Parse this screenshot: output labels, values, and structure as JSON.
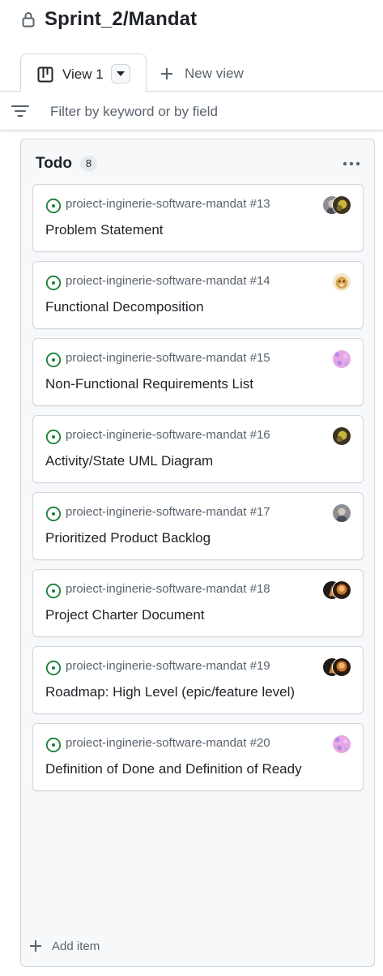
{
  "header": {
    "title": "Sprint_2/Mandat"
  },
  "tabs": {
    "view_label": "View 1",
    "new_view_label": "New view"
  },
  "filter": {
    "placeholder": "Filter by keyword or by field"
  },
  "column": {
    "title": "Todo",
    "count": "8",
    "cards": [
      {
        "repo": "proiect-inginerie-software-mandat #13",
        "title": "Problem Statement",
        "avatars": [
          "avatar-photo-gray",
          "avatar-photo-dark"
        ]
      },
      {
        "repo": "proiect-inginerie-software-mandat #14",
        "title": "Functional Decomposition",
        "avatars": [
          "avatar-doge"
        ]
      },
      {
        "repo": "proiect-inginerie-software-mandat #15",
        "title": "Non-Functional Requirements List",
        "avatars": [
          "avatar-pink-pattern"
        ]
      },
      {
        "repo": "proiect-inginerie-software-mandat #16",
        "title": "Activity/State UML Diagram",
        "avatars": [
          "avatar-photo-dark"
        ]
      },
      {
        "repo": "proiect-inginerie-software-mandat #17",
        "title": "Prioritized Product Backlog",
        "avatars": [
          "avatar-photo-gray"
        ]
      },
      {
        "repo": "proiect-inginerie-software-mandat #18",
        "title": "Project Charter Document",
        "avatars": [
          "avatar-photo-black",
          "avatar-photo-orange"
        ]
      },
      {
        "repo": "proiect-inginerie-software-mandat #19",
        "title": "Roadmap: High Level (epic/feature level)",
        "avatars": [
          "avatar-photo-black",
          "avatar-photo-orange"
        ]
      },
      {
        "repo": "proiect-inginerie-software-mandat #20",
        "title": "Definition of Done and Definition of Ready",
        "avatars": [
          "avatar-pink-pattern"
        ]
      }
    ],
    "add_item_label": "Add item"
  },
  "colors": {
    "open_issue": "#1a7f37",
    "border": "#d0d7de",
    "muted_text": "#59636e",
    "column_bg": "#f6f8fa"
  }
}
